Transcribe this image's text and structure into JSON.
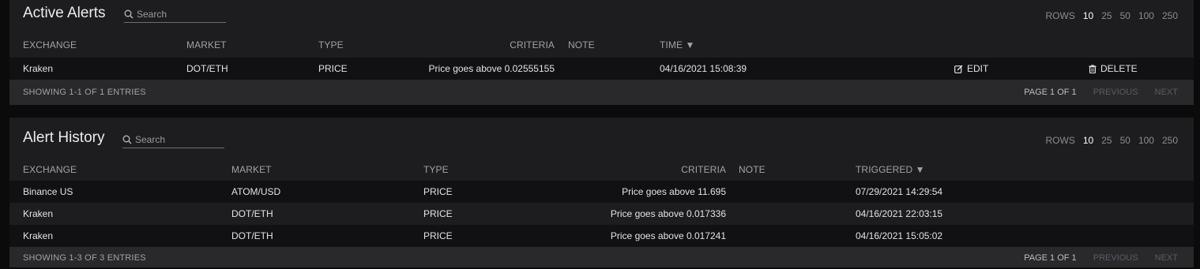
{
  "active_alerts": {
    "title": "Active Alerts",
    "search_placeholder": "Search",
    "rows_label": "ROWS",
    "rows_options": [
      "10",
      "25",
      "50",
      "100",
      "250"
    ],
    "rows_selected": "10",
    "columns": {
      "exchange": "EXCHANGE",
      "market": "MARKET",
      "type": "TYPE",
      "criteria": "CRITERIA",
      "note": "NOTE",
      "time": "TIME ▼"
    },
    "rows": [
      {
        "exchange": "Kraken",
        "market": "DOT/ETH",
        "type": "PRICE",
        "criteria": "Price goes above 0.02555155",
        "note": "",
        "time": "04/16/2021 15:08:39",
        "edit_label": "EDIT",
        "delete_label": "DELETE"
      }
    ],
    "footer_info": "SHOWING 1-1 OF 1 ENTRIES",
    "page_info": "PAGE 1 OF 1",
    "previous_label": "PREVIOUS",
    "next_label": "NEXT"
  },
  "alert_history": {
    "title": "Alert History",
    "search_placeholder": "Search",
    "rows_label": "ROWS",
    "rows_options": [
      "10",
      "25",
      "50",
      "100",
      "250"
    ],
    "rows_selected": "10",
    "columns": {
      "exchange": "EXCHANGE",
      "market": "MARKET",
      "type": "TYPE",
      "criteria": "CRITERIA",
      "note": "NOTE",
      "triggered": "TRIGGERED ▼"
    },
    "rows": [
      {
        "exchange": "Binance US",
        "market": "ATOM/USD",
        "type": "PRICE",
        "criteria": "Price goes above 11.695",
        "note": "",
        "triggered": "07/29/2021 14:29:54"
      },
      {
        "exchange": "Kraken",
        "market": "DOT/ETH",
        "type": "PRICE",
        "criteria": "Price goes above 0.017336",
        "note": "",
        "triggered": "04/16/2021 22:03:15"
      },
      {
        "exchange": "Kraken",
        "market": "DOT/ETH",
        "type": "PRICE",
        "criteria": "Price goes above 0.017241",
        "note": "",
        "triggered": "04/16/2021 15:05:02"
      }
    ],
    "footer_info": "SHOWING 1-3 OF 3 ENTRIES",
    "page_info": "PAGE 1 OF 1",
    "previous_label": "PREVIOUS",
    "next_label": "NEXT"
  },
  "colors": {
    "page_bg": "#0b0b0c",
    "panel_bg": "#1d1d20",
    "row_alt_bg": "#111113",
    "footer_bg": "#29292c",
    "selected_rows": "#ffffff"
  }
}
